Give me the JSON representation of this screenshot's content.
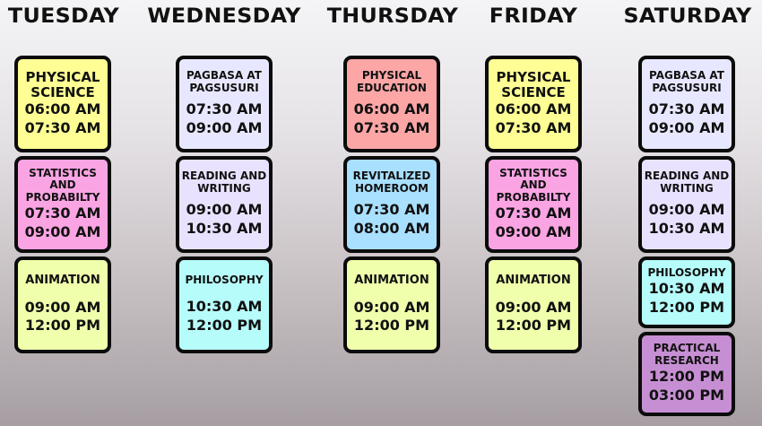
{
  "days": {
    "tuesday": "TUESDAY",
    "wednesday": "WEDNESDAY",
    "thursday": "THURSDAY",
    "friday": "FRIDAY",
    "saturday": "SATURDAY"
  },
  "tuesday": [
    {
      "title": "PHYSICAL SCIENCE",
      "start": "06:00 AM",
      "end": "07:30 AM",
      "color": "#fefe94"
    },
    {
      "title": "STATISTICS AND PROBABILTY",
      "start": "07:30 AM",
      "end": "09:00 AM",
      "color": "#fba4e4"
    },
    {
      "title": "ANIMATION",
      "start": "09:00 AM",
      "end": "12:00 PM",
      "color": "#f0ffac"
    }
  ],
  "wednesday": [
    {
      "title": "PAGBASA AT PAGSUSURI",
      "start": "07:30 AM",
      "end": "09:00 AM",
      "color": "#e7e8ff"
    },
    {
      "title": "READING AND WRITING",
      "start": "09:00 AM",
      "end": "10:30 AM",
      "color": "#e9e2ff"
    },
    {
      "title": "PHILOSOPHY",
      "start": "10:30 AM",
      "end": "12:00 PM",
      "color": "#b6fcfa"
    }
  ],
  "thursday": [
    {
      "title": "PHYSICAL EDUCATION",
      "start": "06:00 AM",
      "end": "07:30 AM",
      "color": "#fca6a6"
    },
    {
      "title": "REVITALIZED HOMEROOM",
      "start": "07:30 AM",
      "end": "08:00 AM",
      "color": "#a9e0ff"
    },
    {
      "title": "ANIMATION",
      "start": "09:00 AM",
      "end": "12:00 PM",
      "color": "#f0ffac"
    }
  ],
  "friday": [
    {
      "title": "PHYSICAL SCIENCE",
      "start": "06:00 AM",
      "end": "07:30 AM",
      "color": "#fefe94"
    },
    {
      "title": "STATISTICS AND PROBABILTY",
      "start": "07:30 AM",
      "end": "09:00 AM",
      "color": "#fba4e4"
    },
    {
      "title": "ANIMATION",
      "start": "09:00 AM",
      "end": "12:00 PM",
      "color": "#f0ffac"
    }
  ],
  "saturday": [
    {
      "title": "PAGBASA AT PAGSUSURI",
      "start": "07:30 AM",
      "end": "09:00 AM",
      "color": "#e7e8ff"
    },
    {
      "title": "READING AND WRITING",
      "start": "09:00 AM",
      "end": "10:30 AM",
      "color": "#e9e2ff"
    },
    {
      "title": "PHILOSOPHY",
      "start": "10:30 AM",
      "end": "12:00 PM",
      "color": "#b6fcfa"
    },
    {
      "title": "PRACTICAL RESEARCH",
      "start": "12:00 PM",
      "end": "03:00 PM",
      "color": "#c78fd3"
    }
  ]
}
